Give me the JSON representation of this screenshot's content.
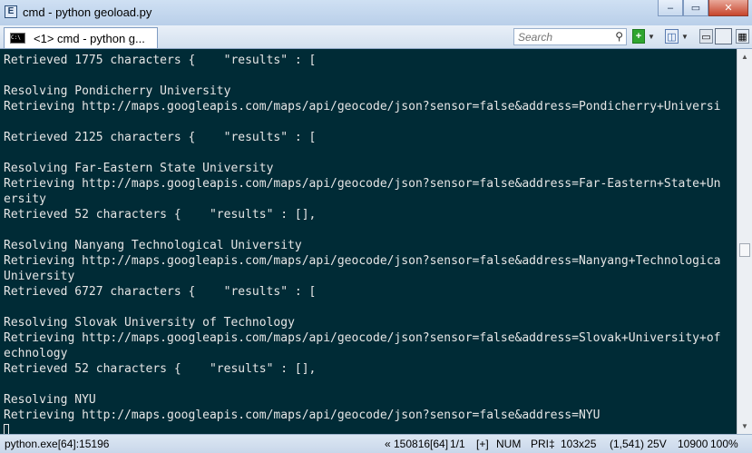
{
  "window": {
    "title": "cmd - python  geoload.py",
    "controls": [
      "–",
      "▭",
      "✕"
    ]
  },
  "toolbar": {
    "tab_label": "<1> cmd - python  g...",
    "search_placeholder": "Search",
    "buttons": [
      "add-console",
      "layout",
      "panel",
      "fullscreen",
      "grid"
    ]
  },
  "console": {
    "lines": [
      "Retrieved 1775 characters {    \"results\" : [",
      "",
      "Resolving Pondicherry University",
      "Retrieving http://maps.googleapis.com/maps/api/geocode/json?sensor=false&address=Pondicherry+Universi",
      "",
      "Retrieved 2125 characters {    \"results\" : [",
      "",
      "Resolving Far-Eastern State University",
      "Retrieving http://maps.googleapis.com/maps/api/geocode/json?sensor=false&address=Far-Eastern+State+Un",
      "ersity",
      "Retrieved 52 characters {    \"results\" : [],",
      "",
      "Resolving Nanyang Technological University",
      "Retrieving http://maps.googleapis.com/maps/api/geocode/json?sensor=false&address=Nanyang+Technologica",
      "University",
      "Retrieved 6727 characters {    \"results\" : [",
      "",
      "Resolving Slovak University of Technology",
      "Retrieving http://maps.googleapis.com/maps/api/geocode/json?sensor=false&address=Slovak+University+of",
      "echnology",
      "Retrieved 52 characters {    \"results\" : [],",
      "",
      "Resolving NYU",
      "Retrieving http://maps.googleapis.com/maps/api/geocode/json?sensor=false&address=NYU"
    ]
  },
  "status": {
    "process": "python.exe[64]:15196",
    "build": "« 150816[64]",
    "page": "1/1",
    "insert": "[+]",
    "num": "NUM",
    "pri": "PRI‡",
    "size": "103x25",
    "cursor": "(1,541) 25V",
    "mem": "10900",
    "zoom": "100%"
  }
}
